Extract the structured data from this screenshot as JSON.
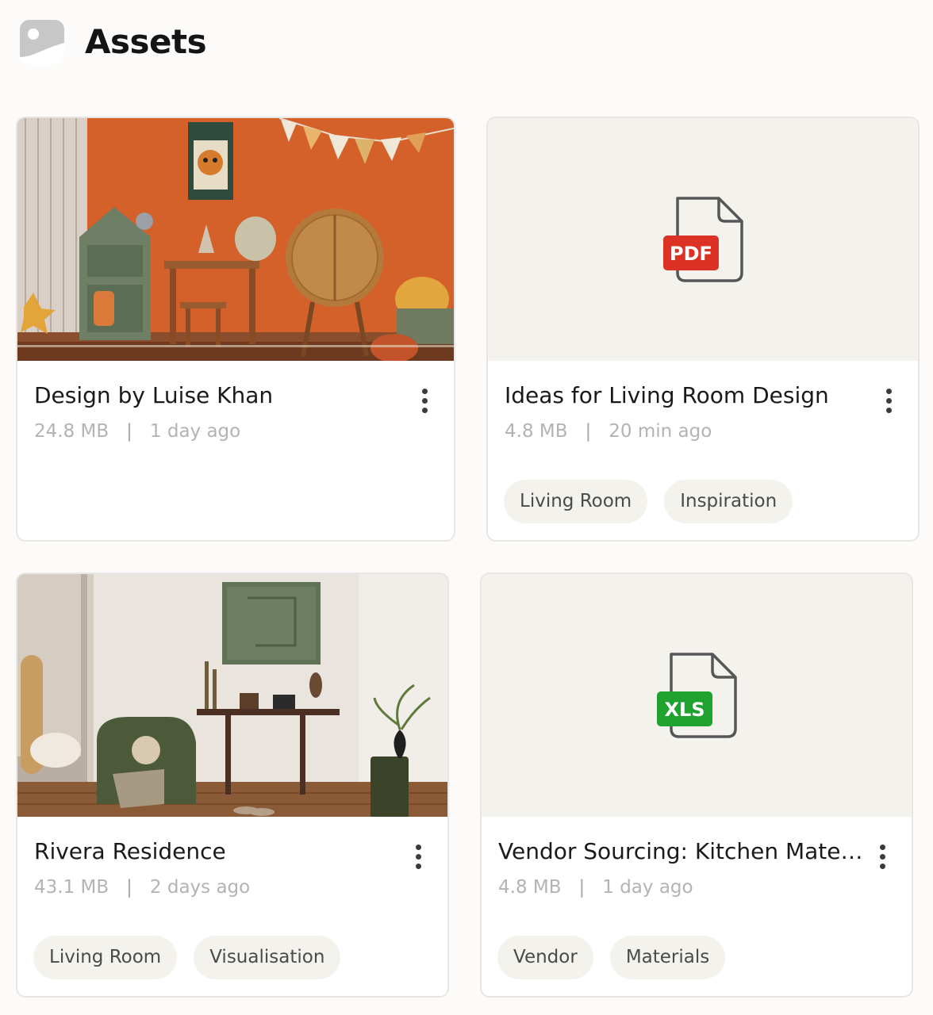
{
  "header": {
    "title": "Assets",
    "icon": "image-icon"
  },
  "cards": [
    {
      "title": "Design by Luise Khan",
      "size": "24.8 MB",
      "time": "1 day ago",
      "thumbnail": "photo",
      "tags": []
    },
    {
      "title": "Ideas for Living Room Design",
      "size": "4.8 MB",
      "time": "20 min ago",
      "thumbnail": "pdf-file-icon",
      "file_badge": "PDF",
      "badge_color": "#dc3226",
      "tags": [
        "Living Room",
        "Inspiration"
      ]
    },
    {
      "title": "Rivera Residence",
      "size": "43.1 MB",
      "time": "2 days ago",
      "thumbnail": "photo",
      "tags": [
        "Living Room",
        "Visualisation"
      ]
    },
    {
      "title": "Vendor Sourcing: Kitchen Materials",
      "size": "4.8 MB",
      "time": "1 day ago",
      "thumbnail": "xls-file-icon",
      "file_badge": "XLS",
      "badge_color": "#1fa22e",
      "tags": [
        "Vendor",
        "Materials"
      ]
    }
  ],
  "meta_separator": "|"
}
